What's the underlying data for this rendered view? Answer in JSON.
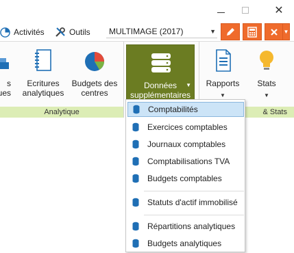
{
  "window": {
    "close_glyph": "✕"
  },
  "toolbar": {
    "activites_label": "Activités",
    "outils_label": "Outils",
    "company_select_value": "MULTIMAGE (2017)",
    "accent_color": "#ef6b2c"
  },
  "ribbon": {
    "partial_button_label": "s\nques",
    "ecritures_label": "Ecritures\nanalytiques",
    "budgets_centres_label": "Budgets des\ncentres",
    "donnees_label": "Données\nsupplémentaires",
    "rapports_label": "Rapports",
    "stats_label": "Stats",
    "group_analytique_label": "Analytique",
    "group_stats_label": "& Stats",
    "group_color": "#dcedb5",
    "active_button_color": "#6b7c22"
  },
  "menu": {
    "items": [
      {
        "label": "Comptabilités",
        "selected": true
      },
      {
        "label": "Exercices comptables"
      },
      {
        "label": "Journaux comptables"
      },
      {
        "label": "Comptabilisations TVA"
      },
      {
        "label": "Budgets comptables"
      },
      {
        "label": "Statuts d'actif immobilisé"
      },
      {
        "label": "Répartitions analytiques"
      },
      {
        "label": "Budgets analytiques"
      }
    ],
    "highlight_color": "#cce4f7"
  }
}
